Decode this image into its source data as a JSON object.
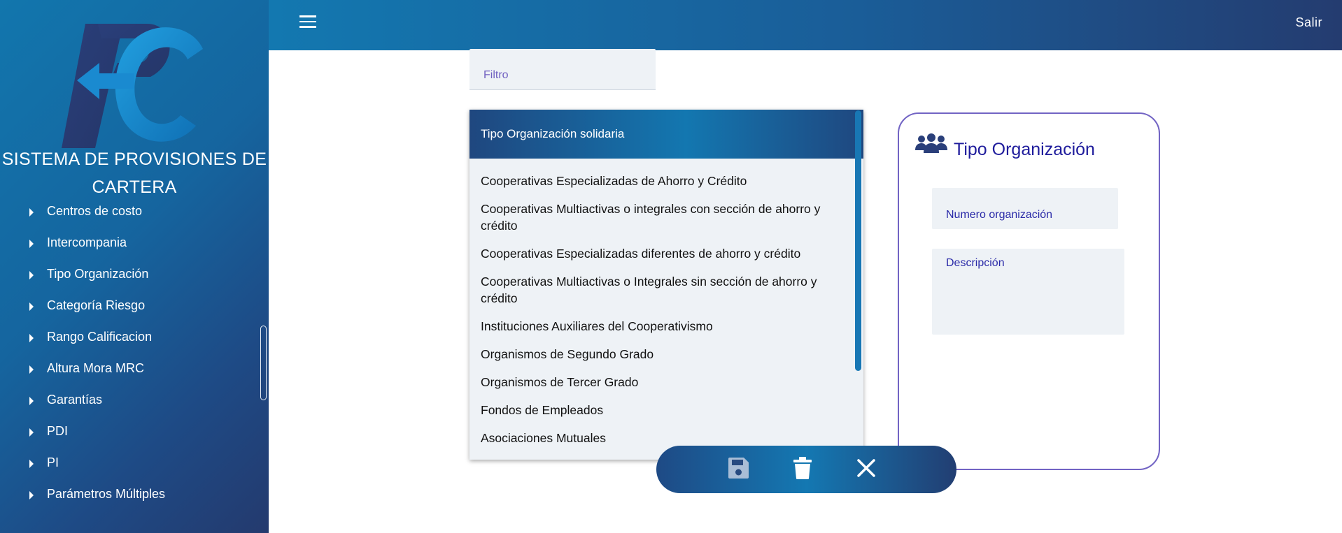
{
  "app": {
    "title": "SISTEMA DE PROVISIONES DE CARTERA",
    "logo": "PC-logo"
  },
  "header": {
    "menu_icon": "hamburger-menu-icon",
    "logout_label": "Salir"
  },
  "sidebar": {
    "items": [
      {
        "label": "Centros de costo"
      },
      {
        "label": "Intercompania"
      },
      {
        "label": "Tipo Organización"
      },
      {
        "label": "Categoría Riesgo"
      },
      {
        "label": "Rango Calificacion"
      },
      {
        "label": "Altura Mora MRC"
      },
      {
        "label": "Garantías"
      },
      {
        "label": "PDI"
      },
      {
        "label": "PI"
      },
      {
        "label": "Parámetros Múltiples"
      }
    ]
  },
  "filter": {
    "placeholder": "Filtro",
    "value": ""
  },
  "list": {
    "header": "Tipo Organización solidaria",
    "items": [
      "Cooperativas Especializadas de Ahorro y Crédito",
      "Cooperativas Multiactivas o integrales con sección de ahorro y crédito",
      "Cooperativas Especializadas diferentes de ahorro y crédito",
      "Cooperativas Multiactivas o Integrales sin sección de ahorro y crédito",
      "Instituciones Auxiliares del Cooperativismo",
      "Organismos de Segundo Grado",
      "Organismos de Tercer Grado",
      "Fondos de Empleados",
      "Asociaciones Mutuales"
    ]
  },
  "form": {
    "icon": "people-group-icon",
    "title": "Tipo Organización",
    "number_placeholder": "Numero organización",
    "description_placeholder": "Descripción"
  },
  "actions": {
    "save_icon": "save-icon",
    "delete_icon": "trash-icon",
    "close_icon": "close-icon"
  },
  "colors": {
    "primary": "#1478b2",
    "dark": "#243a6e",
    "accent": "#7264c4",
    "title": "#1f1c9c"
  }
}
